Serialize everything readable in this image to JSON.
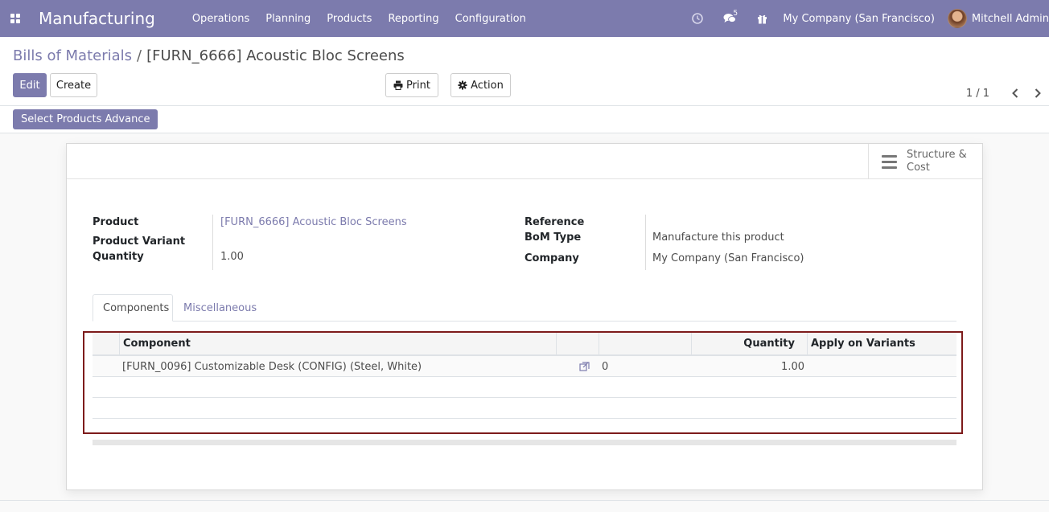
{
  "navbar": {
    "app_name": "Manufacturing",
    "menu": [
      "Operations",
      "Planning",
      "Products",
      "Reporting",
      "Configuration"
    ],
    "messages_count": "5",
    "company": "My Company (San Francisco)",
    "user": "Mitchell Admin"
  },
  "breadcrumb": {
    "parent": "Bills of Materials",
    "separator": "/",
    "current": "[FURN_6666] Acoustic Bloc Screens"
  },
  "toolbar": {
    "edit_label": "Edit",
    "create_label": "Create",
    "print_label": "Print",
    "action_label": "Action"
  },
  "pager": {
    "value": "1 / 1"
  },
  "strip": {
    "advance_button": "Select Products Advance"
  },
  "stat_button": {
    "label": "Structure & Cost"
  },
  "form": {
    "product_label": "Product",
    "product_value": "[FURN_6666] Acoustic Bloc Screens",
    "variant_label": "Product Variant",
    "variant_value": "",
    "quantity_label": "Quantity",
    "quantity_value": "1.00",
    "reference_label": "Reference",
    "reference_value": "",
    "bom_type_label": "BoM Type",
    "bom_type_value": "Manufacture this product",
    "company_label": "Company",
    "company_value": "My Company (San Francisco)"
  },
  "tabs": [
    "Components",
    "Miscellaneous"
  ],
  "table": {
    "headers": {
      "component": "Component",
      "quantity": "Quantity",
      "apply_on_variants": "Apply on Variants"
    },
    "rows": [
      {
        "component": "[FURN_0096] Customizable Desk (CONFIG) (Steel, White)",
        "availability": "0",
        "quantity": "1.00",
        "apply_on_variants": ""
      }
    ]
  },
  "colors": {
    "brand": "#7c7bad",
    "highlight_border": "#7d1b1b"
  }
}
